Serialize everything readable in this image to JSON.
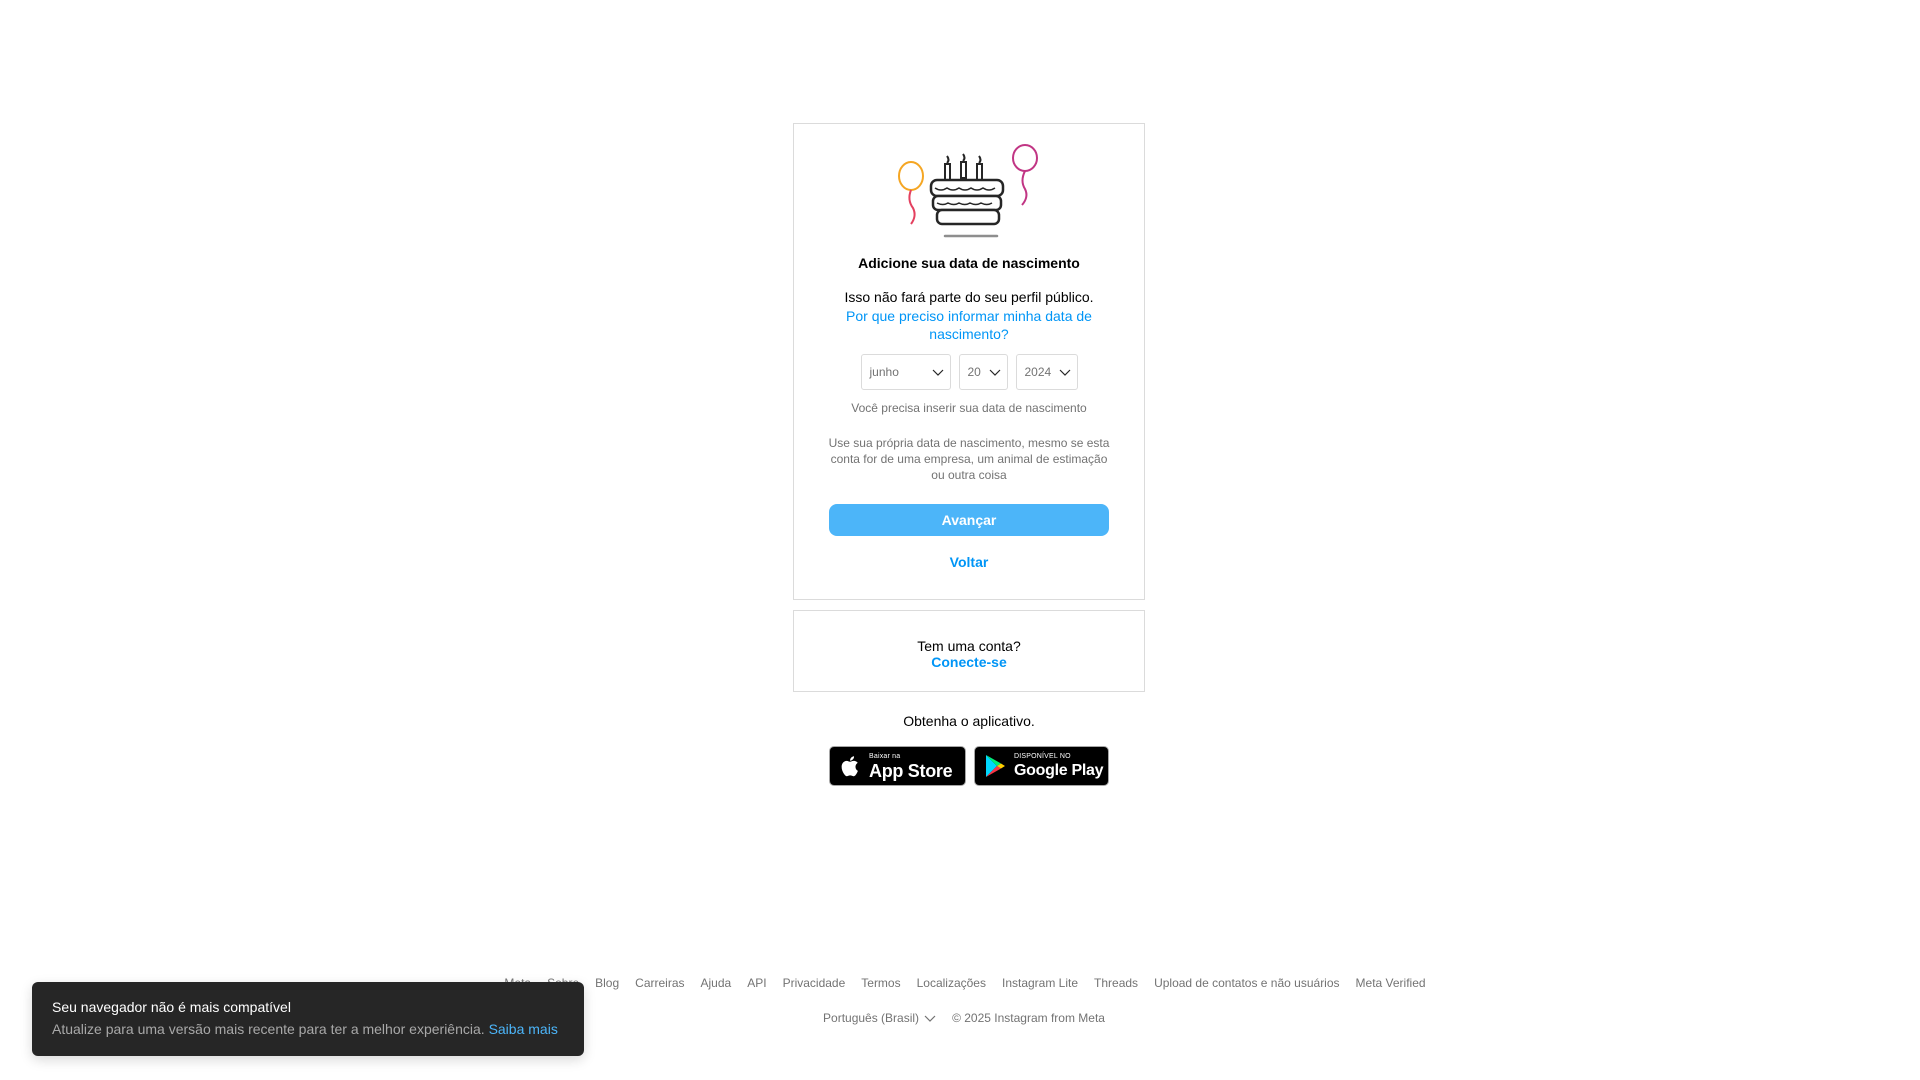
{
  "birthday_card": {
    "illustration_icon": "birthday-cake-with-balloons",
    "title": "Adicione sua data de nascimento",
    "subtitle": "Isso não fará parte do seu perfil público.",
    "why_link": "Por que preciso informar minha data de nascimento?",
    "month_value": "junho",
    "day_value": "20",
    "year_value": "2024",
    "hint": "Você precisa inserir sua data de nascimento",
    "note": "Use sua própria data de nascimento, mesmo se esta conta for de uma empresa, um animal de estimação ou outra coisa",
    "next_button": "Avançar",
    "back_link": "Voltar"
  },
  "login_card": {
    "prompt": "Tem uma conta?",
    "link": "Conecte-se"
  },
  "get_app": {
    "label": "Obtenha o aplicativo.",
    "app_store": {
      "small": "Baixar na",
      "big": "App Store"
    },
    "google_play": {
      "small": "DISPONÍVEL NO",
      "big": "Google Play"
    }
  },
  "footer": {
    "links": [
      "Meta",
      "Sobre",
      "Blog",
      "Carreiras",
      "Ajuda",
      "API",
      "Privacidade",
      "Termos",
      "Localizações",
      "Instagram Lite",
      "Threads",
      "Upload de contatos e não usuários",
      "Meta Verified"
    ],
    "language": "Português (Brasil)",
    "copyright": "© 2025 Instagram from Meta"
  },
  "toast": {
    "title": "Seu navegador não é mais compatível",
    "body": "Atualize para uma versão mais recente para ter a melhor experiência.",
    "link": "Saiba mais"
  },
  "colors": {
    "accent": "#0095f6",
    "button": "#4cb5f9",
    "muted_text": "#737373",
    "border": "#dbdbdb",
    "toast_bg": "#262626"
  }
}
